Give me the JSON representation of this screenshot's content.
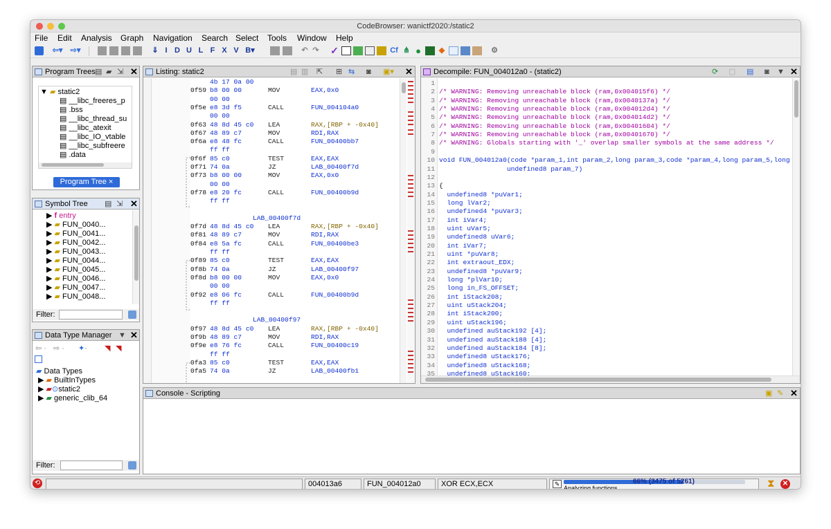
{
  "window": {
    "title": "CodeBrowser: wanictf2020:/static2"
  },
  "menu": [
    "File",
    "Edit",
    "Analysis",
    "Graph",
    "Navigation",
    "Search",
    "Select",
    "Tools",
    "Window",
    "Help"
  ],
  "program_trees": {
    "title": "Program Trees",
    "root": "static2",
    "items": [
      "__libc_freeres_p",
      ".bss",
      "__libc_thread_su",
      "__libc_atexit",
      "__libc_IO_vtable",
      "__libc_subfreere",
      ".data"
    ],
    "tab": "Program Tree ×"
  },
  "symbol_tree": {
    "title": "Symbol Tree",
    "items": [
      "entry",
      "FUN_0040...",
      "FUN_0041...",
      "FUN_0042...",
      "FUN_0043...",
      "FUN_0044...",
      "FUN_0045...",
      "FUN_0046...",
      "FUN_0047...",
      "FUN_0048..."
    ],
    "filter_label": "Filter:"
  },
  "data_type_manager": {
    "title": "Data Type Manager",
    "items": [
      "Data Types",
      "BuiltInTypes",
      "static2",
      "generic_clib_64"
    ],
    "filter_label": "Filter:"
  },
  "listing": {
    "title": "Listing:  static2",
    "rows": [
      {
        "addr": "",
        "bytes": "4b 17 0a 00",
        "mn": "",
        "op": ""
      },
      {
        "addr": "0f59",
        "bytes": "b8 00 00",
        "mn": "MOV",
        "op": "EAX,0x0"
      },
      {
        "addr": "",
        "bytes": "00 00",
        "mn": "",
        "op": ""
      },
      {
        "addr": "0f5e",
        "bytes": "e8 3d f5",
        "mn": "CALL",
        "op": "FUN_004104a0"
      },
      {
        "addr": "",
        "bytes": "00 00",
        "mn": "",
        "op": ""
      },
      {
        "addr": "0f63",
        "bytes": "48 8d 45 c0",
        "mn": "LEA",
        "op": "RAX,[RBP + -0x40]"
      },
      {
        "addr": "0f67",
        "bytes": "48 89 c7",
        "mn": "MOV",
        "op": "RDI,RAX"
      },
      {
        "addr": "0f6a",
        "bytes": "e8 48 fc",
        "mn": "CALL",
        "op": "FUN_00400bb7"
      },
      {
        "addr": "",
        "bytes": "ff ff",
        "mn": "",
        "op": ""
      },
      {
        "addr": "0f6f",
        "bytes": "85 c0",
        "mn": "TEST",
        "op": "EAX,EAX"
      },
      {
        "addr": "0f71",
        "bytes": "74 0a",
        "mn": "JZ",
        "op": "LAB_00400f7d"
      },
      {
        "addr": "0f73",
        "bytes": "b8 00 00",
        "mn": "MOV",
        "op": "EAX,0x0"
      },
      {
        "addr": "",
        "bytes": "00 00",
        "mn": "",
        "op": ""
      },
      {
        "addr": "0f78",
        "bytes": "e8 20 fc",
        "mn": "CALL",
        "op": "FUN_00400b9d"
      },
      {
        "addr": "",
        "bytes": "ff ff",
        "mn": "",
        "op": ""
      },
      {
        "addr": "",
        "bytes": "",
        "mn": "",
        "op": ""
      },
      {
        "addr": "",
        "bytes": "",
        "mn": "",
        "op": "",
        "label": "LAB_00400f7d"
      },
      {
        "addr": "0f7d",
        "bytes": "48 8d 45 c0",
        "mn": "LEA",
        "op": "RAX,[RBP + -0x40]"
      },
      {
        "addr": "0f81",
        "bytes": "48 89 c7",
        "mn": "MOV",
        "op": "RDI,RAX"
      },
      {
        "addr": "0f84",
        "bytes": "e8 5a fc",
        "mn": "CALL",
        "op": "FUN_00400be3"
      },
      {
        "addr": "",
        "bytes": "ff ff",
        "mn": "",
        "op": ""
      },
      {
        "addr": "0f89",
        "bytes": "85 c0",
        "mn": "TEST",
        "op": "EAX,EAX"
      },
      {
        "addr": "0f8b",
        "bytes": "74 0a",
        "mn": "JZ",
        "op": "LAB_00400f97"
      },
      {
        "addr": "0f8d",
        "bytes": "b8 00 00",
        "mn": "MOV",
        "op": "EAX,0x0"
      },
      {
        "addr": "",
        "bytes": "00 00",
        "mn": "",
        "op": ""
      },
      {
        "addr": "0f92",
        "bytes": "e8 06 fc",
        "mn": "CALL",
        "op": "FUN_00400b9d"
      },
      {
        "addr": "",
        "bytes": "ff ff",
        "mn": "",
        "op": ""
      },
      {
        "addr": "",
        "bytes": "",
        "mn": "",
        "op": ""
      },
      {
        "addr": "",
        "bytes": "",
        "mn": "",
        "op": "",
        "label": "LAB_00400f97"
      },
      {
        "addr": "0f97",
        "bytes": "48 8d 45 c0",
        "mn": "LEA",
        "op": "RAX,[RBP + -0x40]"
      },
      {
        "addr": "0f9b",
        "bytes": "48 89 c7",
        "mn": "MOV",
        "op": "RDI,RAX"
      },
      {
        "addr": "0f9e",
        "bytes": "e8 76 fc",
        "mn": "CALL",
        "op": "FUN_00400c19"
      },
      {
        "addr": "",
        "bytes": "ff ff",
        "mn": "",
        "op": ""
      },
      {
        "addr": "0fa3",
        "bytes": "85 c0",
        "mn": "TEST",
        "op": "EAX,EAX"
      },
      {
        "addr": "0fa5",
        "bytes": "74 0a",
        "mn": "JZ",
        "op": "LAB_00400fb1"
      }
    ]
  },
  "decompile": {
    "title": "Decompile: FUN_004012a0 -  (static2)",
    "lines": [
      {
        "n": "1",
        "t": ""
      },
      {
        "n": "2",
        "t": "/* WARNING: Removing unreachable block (ram,0x004015f6) */",
        "cls": "c-purp"
      },
      {
        "n": "3",
        "t": "/* WARNING: Removing unreachable block (ram,0x0040137a) */",
        "cls": "c-purp"
      },
      {
        "n": "4",
        "t": "/* WARNING: Removing unreachable block (ram,0x004012d4) */",
        "cls": "c-purp"
      },
      {
        "n": "5",
        "t": "/* WARNING: Removing unreachable block (ram,0x004014d2) */",
        "cls": "c-purp"
      },
      {
        "n": "6",
        "t": "/* WARNING: Removing unreachable block (ram,0x00401604) */",
        "cls": "c-purp"
      },
      {
        "n": "7",
        "t": "/* WARNING: Removing unreachable block (ram,0x00401670) */",
        "cls": "c-purp"
      },
      {
        "n": "8",
        "t": "/* WARNING: Globals starting with '_' overlap smaller symbols at the same address */",
        "cls": "c-purp"
      },
      {
        "n": "9",
        "t": ""
      },
      {
        "n": "10",
        "t": "void FUN_004012a0(code *param_1,int param_2,long param_3,code *param_4,long param_5,long param",
        "cls": "c-blue"
      },
      {
        "n": "11",
        "t": "                 undefined8 param_7)",
        "cls": "c-blue"
      },
      {
        "n": "12",
        "t": ""
      },
      {
        "n": "13",
        "t": "{"
      },
      {
        "n": "14",
        "t": "  undefined8 *puVar1;",
        "cls": "c-blue"
      },
      {
        "n": "15",
        "t": "  long lVar2;",
        "cls": "c-blue"
      },
      {
        "n": "16",
        "t": "  undefined4 *puVar3;",
        "cls": "c-blue"
      },
      {
        "n": "17",
        "t": "  int iVar4;",
        "cls": "c-blue"
      },
      {
        "n": "18",
        "t": "  uint uVar5;",
        "cls": "c-blue"
      },
      {
        "n": "19",
        "t": "  undefined8 uVar6;",
        "cls": "c-blue"
      },
      {
        "n": "20",
        "t": "  int iVar7;",
        "cls": "c-blue"
      },
      {
        "n": "21",
        "t": "  uint *puVar8;",
        "cls": "c-blue"
      },
      {
        "n": "22",
        "t": "  int extraout_EDX;",
        "cls": "c-blue"
      },
      {
        "n": "23",
        "t": "  undefined8 *puVar9;",
        "cls": "c-blue"
      },
      {
        "n": "24",
        "t": "  long *plVar10;",
        "cls": "c-blue"
      },
      {
        "n": "25",
        "t": "  long in_FS_OFFSET;",
        "cls": "c-blue"
      },
      {
        "n": "26",
        "t": "  int iStack208;",
        "cls": "c-blue"
      },
      {
        "n": "27",
        "t": "  uint uStack204;",
        "cls": "c-blue"
      },
      {
        "n": "28",
        "t": "  int iStack200;",
        "cls": "c-blue"
      },
      {
        "n": "29",
        "t": "  uint uStack196;",
        "cls": "c-blue"
      },
      {
        "n": "30",
        "t": "  undefined auStack192 [4];",
        "cls": "c-blue"
      },
      {
        "n": "31",
        "t": "  undefined auStack188 [4];",
        "cls": "c-blue"
      },
      {
        "n": "32",
        "t": "  undefined auStack184 [8];",
        "cls": "c-blue"
      },
      {
        "n": "33",
        "t": "  undefined8 uStack176;",
        "cls": "c-blue"
      },
      {
        "n": "34",
        "t": "  undefined8 uStack168;",
        "cls": "c-blue"
      },
      {
        "n": "35",
        "t": "  undefined8 uStack160;",
        "cls": "c-blue"
      }
    ]
  },
  "console": {
    "title": "Console - Scripting"
  },
  "status": {
    "address": "004013a6",
    "function": "FUN_004012a0",
    "instruction": "XOR ECX,ECX",
    "progress_text": "66% (3475 of 5261)",
    "progress_fraction": 0.66,
    "analyzing": "Analyzing functions..."
  },
  "colors": {
    "accent": "#2f6bd8",
    "comment": "#a000a0",
    "symbol": "#1030d0",
    "error": "#d02020"
  }
}
